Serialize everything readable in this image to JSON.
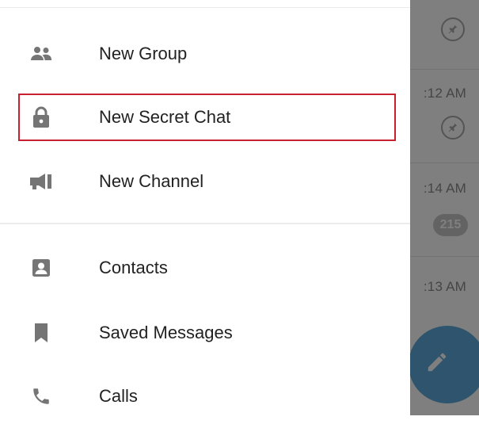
{
  "drawer": {
    "items": [
      {
        "label": "New Group",
        "icon": "group-icon"
      },
      {
        "label": "New Secret Chat",
        "icon": "lock-icon"
      },
      {
        "label": "New Channel",
        "icon": "megaphone-icon"
      },
      {
        "label": "Contacts",
        "icon": "contact-card-icon"
      },
      {
        "label": "Saved Messages",
        "icon": "bookmark-icon"
      },
      {
        "label": "Calls",
        "icon": "phone-icon"
      }
    ],
    "highlighted_item": "New Secret Chat"
  },
  "chat_list": {
    "times": [
      ":12 AM",
      ":14 AM",
      ":13 AM"
    ],
    "unread_count": "215"
  },
  "colors": {
    "icon": "#757575",
    "label": "#222222",
    "highlight_border": "#c7202f",
    "fab": "#5fa9dd",
    "badge": "#c6c6c6"
  }
}
